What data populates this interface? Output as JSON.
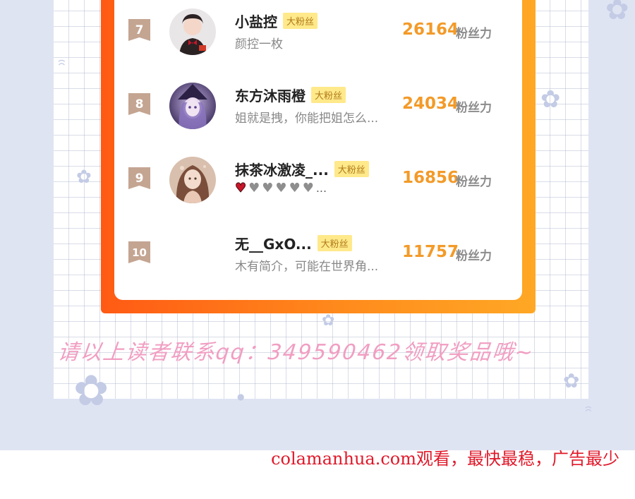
{
  "ranking": [
    {
      "rank": "7",
      "name": "小盐控",
      "tag": "大粉丝",
      "bio": "颜控一枚",
      "count": "26164",
      "count_label": "粉丝力",
      "avatar_icon": "girl-with-bow-avatar"
    },
    {
      "rank": "8",
      "name": "东方沐雨橙",
      "tag": "大粉丝",
      "bio": "姐就是拽，你能把姐怎么...",
      "count": "24034",
      "count_label": "粉丝力",
      "avatar_icon": "anime-witch-avatar"
    },
    {
      "rank": "9",
      "name": "抹茶冰激凌_...",
      "tag": "大粉丝",
      "bio_hearts": [
        "red-heart-icon",
        "gray-heart-icon",
        "gray-heart-icon",
        "gray-heart-icon",
        "gray-heart-icon",
        "gray-heart-icon"
      ],
      "bio_more": "...",
      "count": "16856",
      "count_label": "粉丝力",
      "avatar_icon": "anime-girl-avatar"
    },
    {
      "rank": "10",
      "name": "无__GxO...",
      "tag": "大粉丝",
      "bio": "木有简介，可能在世界角...",
      "count": "11757",
      "count_label": "粉丝力"
    }
  ],
  "contact_text": "请以上读者联系qq：349590462领取奖品哦~",
  "footer_watermark": "colamanhua.com观看，最快最稳，广告最少",
  "colors": {
    "frame_gradient_start": "#ff5a14",
    "frame_gradient_end": "#ffa825",
    "count_color": "#f39a28",
    "tag_bg": "#ffe98a",
    "rank_badge": "#c4a592",
    "contact_pink": "#f19ec2",
    "watermark_red": "#e0192a"
  }
}
